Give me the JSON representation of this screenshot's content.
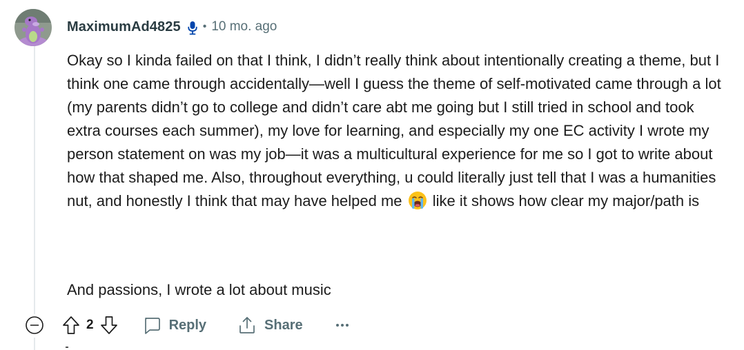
{
  "comment": {
    "username": "MaximumAd4825",
    "separator": "•",
    "timestamp": "10 mo. ago",
    "body": [
      "Okay so I kinda failed on that I think, I didn’t really think about intentionally creating a theme, but I think one came through accidentally—well I guess the theme of self-motivated came through a lot (my parents didn’t go to college and didn’t care abt me going but I still tried in school and took extra courses each summer), my love for learning, and especially my one EC activity I wrote my person statement on was my job—it was a multicultural experience for me so I got to write about how that shaped me. Also, throughout everything, u could literally just tell that I was a humanities nut, and honestly I think that may have helped me",
      "like it shows how clear my major/path is"
    ],
    "emoji": "loudly-crying-face-emoji",
    "body_second_paragraph": "And passions, I wrote a lot about music",
    "avatar_icon": "snoo-avatar-icon",
    "flair_icon": "microphone-icon"
  },
  "actions": {
    "collapse_icon": "collapse-minus-icon",
    "upvote_icon": "upvote-arrow-icon",
    "score": "2",
    "downvote_icon": "downvote-arrow-icon",
    "reply_label": "Reply",
    "reply_icon": "comment-bubble-icon",
    "share_label": "Share",
    "share_icon": "share-icon",
    "more_icon": "more-options-icon"
  },
  "colors": {
    "username": "#2a3c42",
    "meta": "#576f76",
    "text": "#1c1c1c",
    "thread_line": "#e5e9ec",
    "mic_blue": "#0045ac"
  }
}
